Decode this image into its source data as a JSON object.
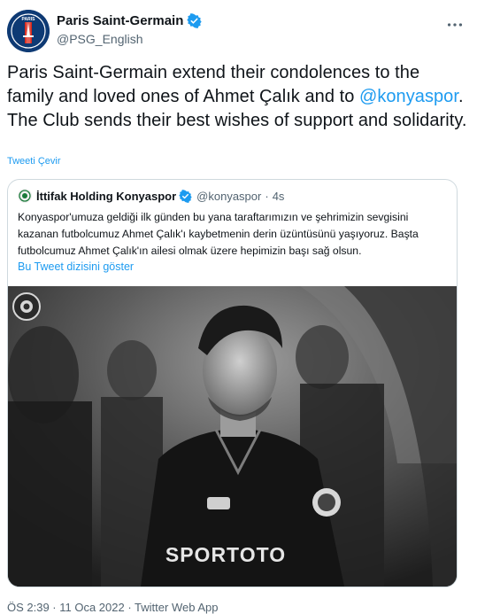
{
  "author": {
    "display_name": "Paris Saint-Germain",
    "handle": "@PSG_English",
    "avatar_text": "PARIS"
  },
  "tweet": {
    "text_before": "Paris Saint-Germain extend their condolences to the family and loved ones of Ahmet Çalık and to ",
    "mention": "@konyaspor",
    "text_after": ". The Club sends their best wishes of support and solidarity.",
    "translate_label": "Tweeti Çevir"
  },
  "quote": {
    "display_name": "İttifak Holding Konyaspor",
    "handle": "@konyaspor",
    "separator": "·",
    "time": "4s",
    "text": "Konyaspor'umuza geldiği ilk günden bu yana taraftarımızın ve şehrimizin sevgisini kazanan futbolcumuz Ahmet Çalık'ı kaybetmenin derin üzüntüsünü yaşıyoruz. Başta futbolcumuz Ahmet Çalık'ın ailesi olmak üzere hepimizin başı sağ olsun.",
    "show_thread": "Bu Tweet dizisini göster",
    "photo": {
      "jersey_sponsor": "SPORTOTO",
      "sponsor_sub": "SPORTOTO"
    }
  },
  "footer": {
    "text": "ÖS 2:39 · 11 Oca 2022 · Twitter Web App"
  },
  "colors": {
    "accent": "#1d9bf0",
    "psg_blue": "#0e3a74",
    "psg_red": "#da291c"
  },
  "icons": [
    "verified-badge-icon",
    "more-options-icon"
  ]
}
